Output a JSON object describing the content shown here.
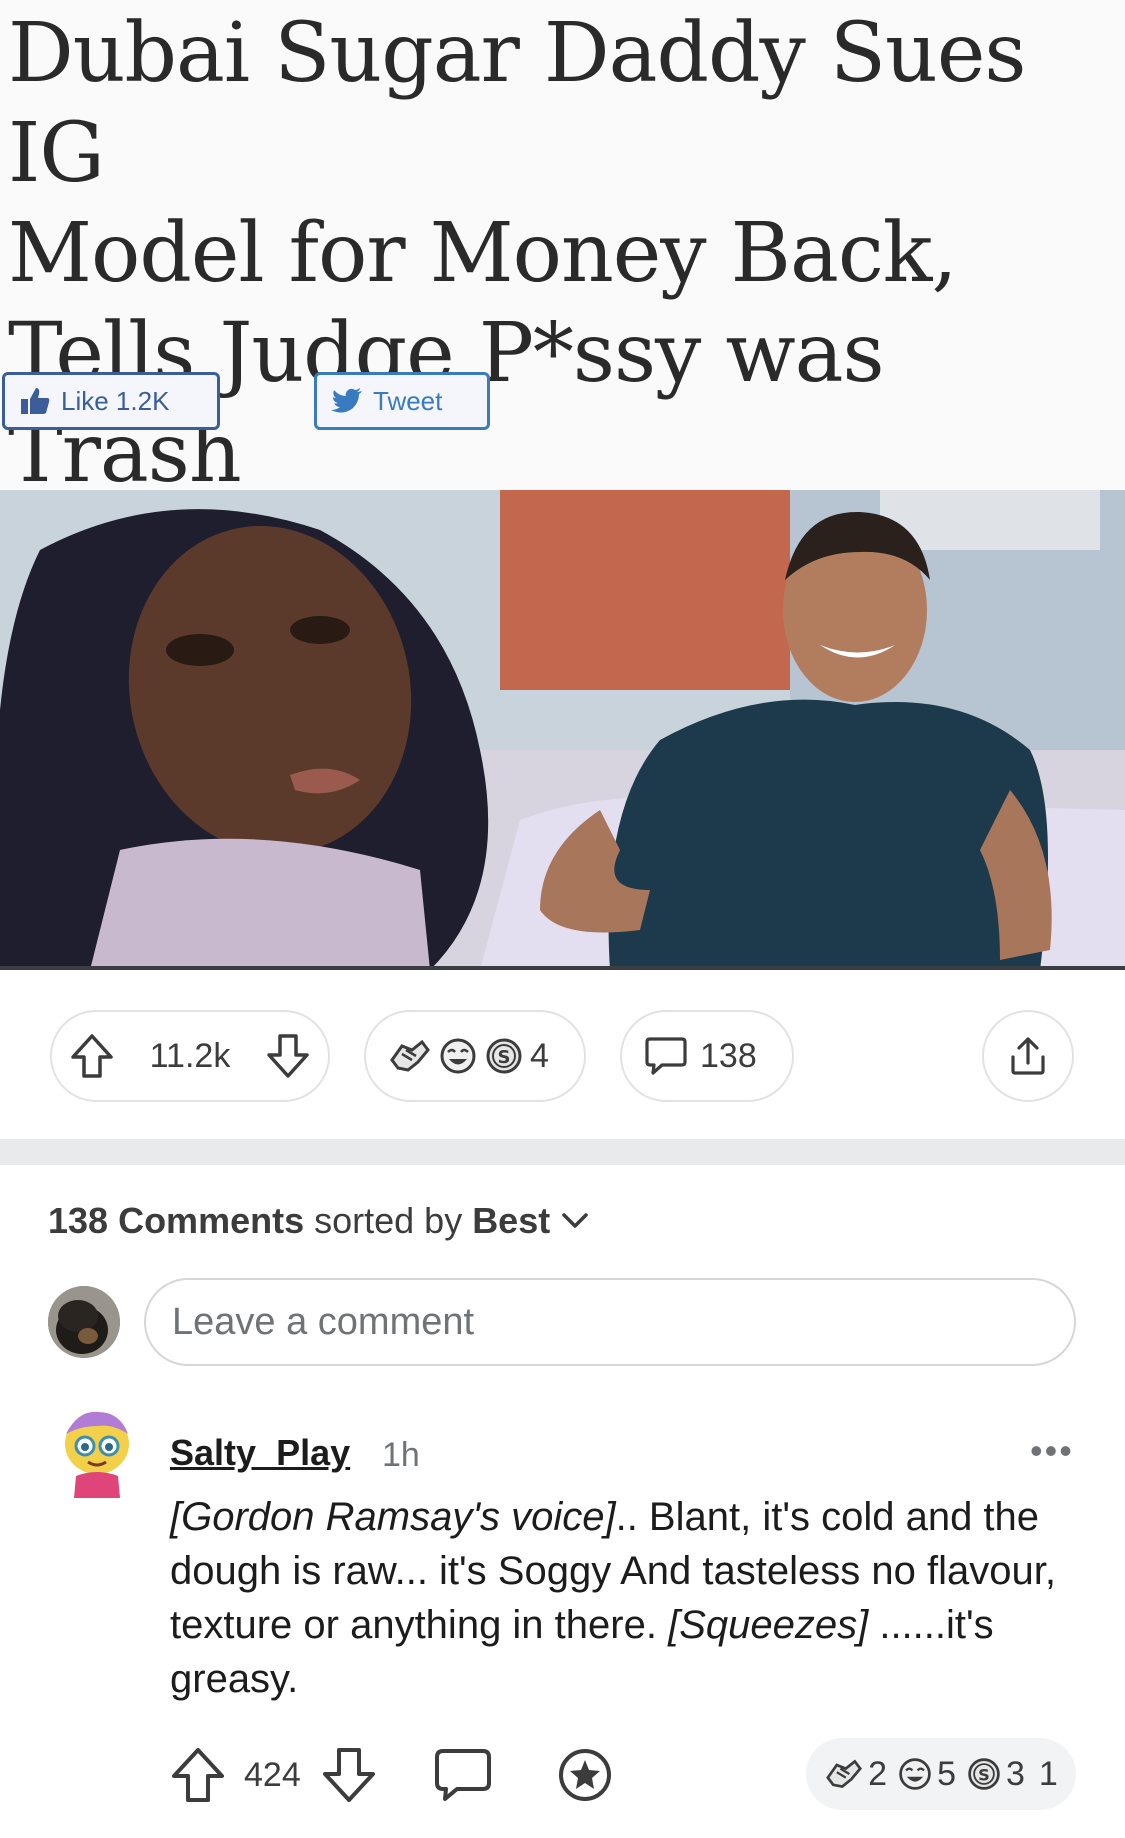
{
  "meme": {
    "headline": "Dubai Sugar Daddy Sues IG\nModel for Money Back,\nTells Judge P*ssy was Trash",
    "like_label": "Like 1.2K",
    "tweet_label": "Tweet"
  },
  "post": {
    "upvotes": "11.2k",
    "award_count": "4",
    "comment_count": "138"
  },
  "comments_header": {
    "count_label": "138 Comments",
    "sorted_by": "sorted by",
    "sort_value": "Best"
  },
  "comment_input": {
    "placeholder": "Leave a comment"
  },
  "comment": {
    "username": "Salty_Play",
    "time": "1h",
    "more": "•••",
    "body_italic_1": "[Gordon Ramsay's voice]",
    "body_text_1": ".. Blant, it's cold and the dough is raw... it's Soggy And tasteless no flavour, texture or anything in there.",
    "body_italic_2": "[Squeezes]",
    "body_text_2": " ......it's greasy.",
    "score": "424",
    "awards": [
      {
        "icon": "handshake-award-icon",
        "count": "2"
      },
      {
        "icon": "laughing-award-icon",
        "count": "5"
      },
      {
        "icon": "coin-award-icon",
        "count": "3"
      },
      {
        "icon": "extra-award-count",
        "count": "1"
      }
    ]
  },
  "colors": {
    "text": "#1c1c1c",
    "muted": "#6f7376",
    "border": "#e1e2e4",
    "divider": "#e9eaec",
    "facebook": "#3b5e9a",
    "twitter": "#3a7bbf"
  }
}
